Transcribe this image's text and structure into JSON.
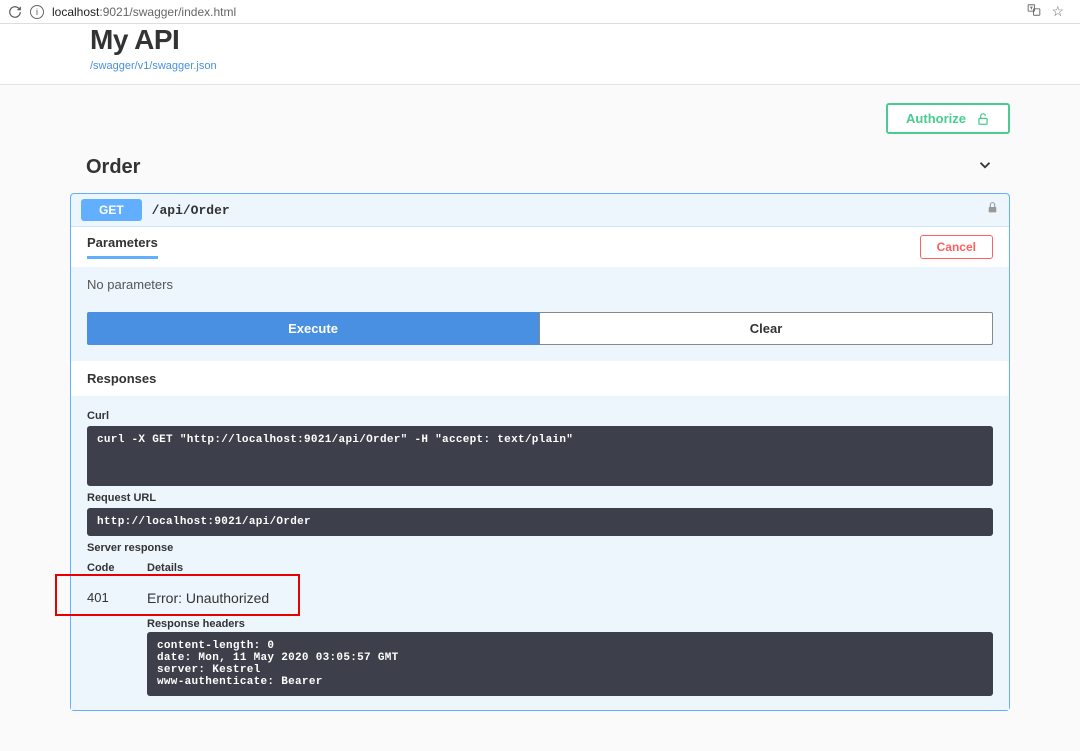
{
  "browser": {
    "url_host": "localhost",
    "url_path": ":9021/swagger/index.html"
  },
  "header": {
    "title": "My API",
    "json_link": "/swagger/v1/swagger.json"
  },
  "authorize": {
    "label": "Authorize"
  },
  "tag": {
    "name": "Order"
  },
  "operation": {
    "method": "GET",
    "path": "/api/Order"
  },
  "params": {
    "title": "Parameters",
    "cancel": "Cancel",
    "none": "No parameters"
  },
  "actions": {
    "execute": "Execute",
    "clear": "Clear"
  },
  "responses": {
    "title": "Responses",
    "curl_label": "Curl",
    "curl_value": "curl -X GET \"http://localhost:9021/api/Order\" -H \"accept: text/plain\"",
    "request_url_label": "Request URL",
    "request_url_value": "http://localhost:9021/api/Order",
    "server_response_label": "Server response",
    "code_col": "Code",
    "details_col": "Details",
    "code": "401",
    "error": "Error: Unauthorized",
    "response_headers_label": "Response headers",
    "response_headers_value": "content-length: 0\ndate: Mon, 11 May 2020 03:05:57 GMT\nserver: Kestrel\nwww-authenticate: Bearer"
  }
}
